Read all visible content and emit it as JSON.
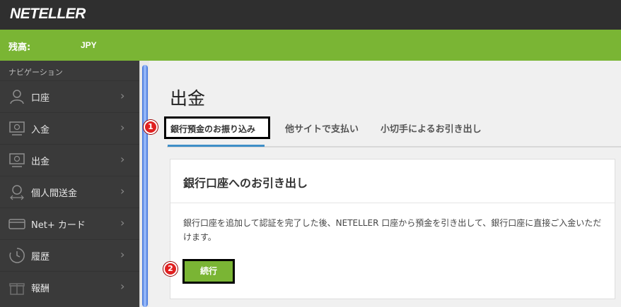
{
  "header": {
    "logo": "NETELLER"
  },
  "balance": {
    "label": "残高:",
    "currency": "JPY"
  },
  "sidebar": {
    "header": "ナビゲーション",
    "items": [
      {
        "label": "口座",
        "icon": "user-icon"
      },
      {
        "label": "入金",
        "icon": "monitor-deposit-icon"
      },
      {
        "label": "出金",
        "icon": "monitor-withdraw-icon"
      },
      {
        "label": "個人間送金",
        "icon": "transfer-icon"
      },
      {
        "label": "Net+ カード",
        "icon": "card-icon"
      },
      {
        "label": "履歴",
        "icon": "history-icon"
      },
      {
        "label": "報酬",
        "icon": "gift-icon"
      }
    ]
  },
  "main": {
    "title": "出金",
    "tabs": [
      {
        "label": "銀行預金のお振り込み",
        "active": true
      },
      {
        "label": "他サイトで支払い",
        "active": false
      },
      {
        "label": "小切手によるお引き出し",
        "active": false
      }
    ],
    "panel": {
      "title": "銀行口座へのお引き出し",
      "text": "銀行口座を追加して認証を完了した後、NETELLER 口座から預金を引き出して、銀行口座に直接ご入金いただけます。",
      "button": "続行"
    }
  },
  "annotations": {
    "marker1": "1",
    "marker2": "2"
  },
  "colors": {
    "brand_green": "#7ab534",
    "sidebar": "#3a3a3a",
    "topbar": "#2f2f2f",
    "tab_accent": "#3f8fc7",
    "marker_red": "#e02020"
  }
}
